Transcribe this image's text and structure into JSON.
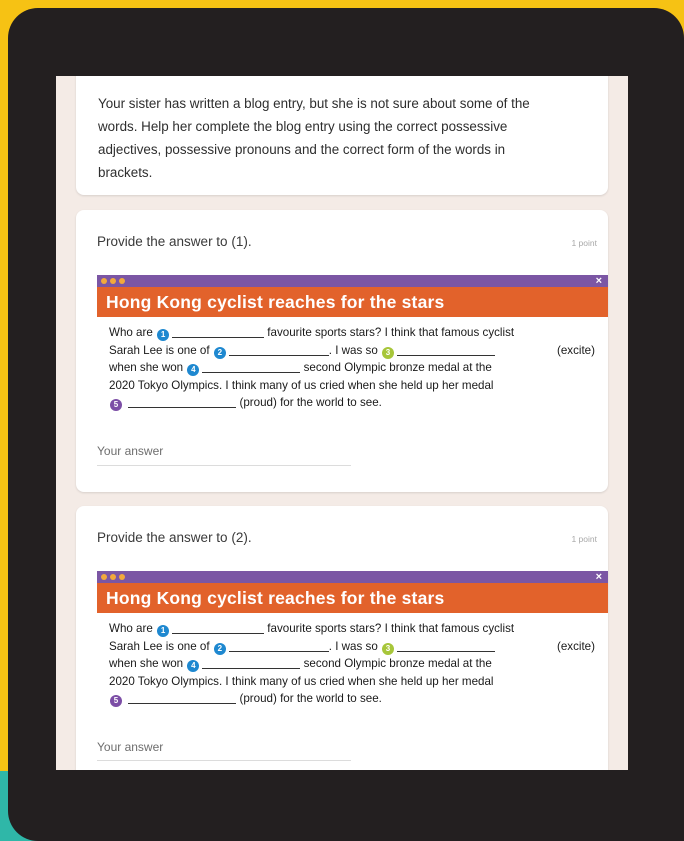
{
  "intro": {
    "lines": [
      "Your sister has written a blog entry, but she is not sure about some of the",
      "words. Help her complete the blog entry using the correct possessive",
      "adjectives, possessive pronouns and the correct form of the words in",
      "brackets."
    ]
  },
  "blog": {
    "title": "Hong Kong cyclist reaches for the stars",
    "close": "×",
    "s1a": "Who are",
    "s1b": "favourite sports stars? I think that famous cyclist",
    "s2a": "Sarah Lee is one of",
    "s2b": ". I was so",
    "s2c": "(excite)",
    "s3a": "when she won",
    "s3b": "second Olympic bronze medal at the",
    "s4": "2020 Tokyo Olympics. I think many of us cried when she held up her medal",
    "s5b": "(proud) for the world to see.",
    "badges": [
      "1",
      "2",
      "3",
      "4",
      "5"
    ]
  },
  "questions": [
    {
      "title": "Provide the answer to (1).",
      "points": "1 point",
      "answer_placeholder": "Your answer"
    },
    {
      "title": "Provide the answer to (2).",
      "points": "1 point",
      "answer_placeholder": "Your answer"
    }
  ],
  "colors": {
    "background": "#f6c214",
    "device": "#231f20",
    "blog_bar": "#7b56a4",
    "blog_header": "#e2622b",
    "badge_blue": "#1e88d0",
    "badge_green": "#a7c63a",
    "badge_purple": "#7c4ea6"
  }
}
